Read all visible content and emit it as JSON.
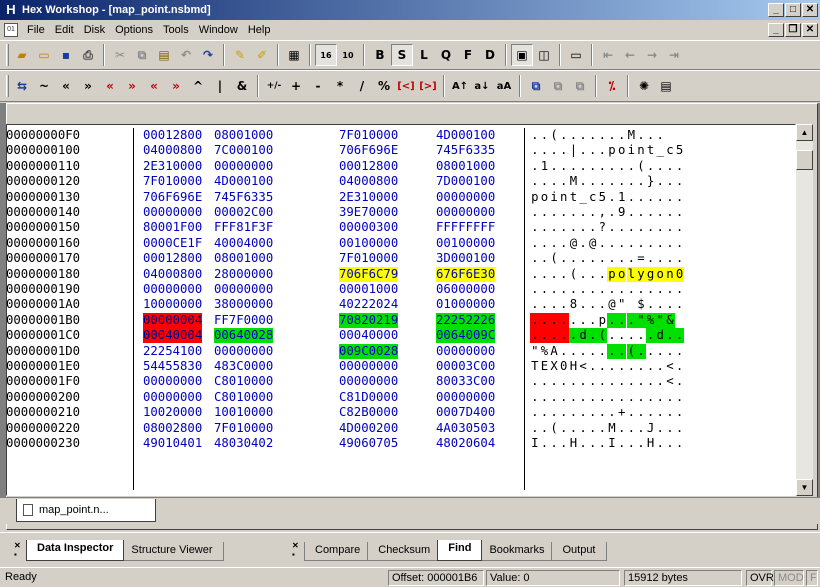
{
  "window": {
    "app_icon": "H",
    "title": "Hex Workshop - [map_point.nsbmd]"
  },
  "menu": [
    "File",
    "Edit",
    "Disk",
    "Options",
    "Tools",
    "Window",
    "Help"
  ],
  "toolbar1": {
    "edit_letters": [
      "B",
      "S",
      "L",
      "Q",
      "F",
      "D"
    ]
  },
  "toolbar2": {
    "ops": [
      "⇆",
      "~",
      "«",
      "»",
      "«",
      "»",
      "«",
      "»",
      "^",
      "|",
      "&",
      "+/-",
      "+",
      "-",
      "*",
      "/",
      "%",
      "[<]",
      "[>]",
      "A↑",
      "a↓",
      "aA"
    ]
  },
  "hex": {
    "rows": [
      {
        "addr": "00000000F0",
        "cols": [
          "00012800",
          "08001000",
          "7F010000",
          "4D000100"
        ],
        "ascii": "..(.......M..."
      },
      {
        "addr": "0000000100",
        "cols": [
          "04000800",
          "7C000100",
          "706F696E",
          "745F6335"
        ],
        "ascii": "....|...point_c5"
      },
      {
        "addr": "0000000110",
        "cols": [
          "2E310000",
          "00000000",
          "00012800",
          "08001000"
        ],
        "ascii": ".1.........(...."
      },
      {
        "addr": "0000000120",
        "cols": [
          "7F010000",
          "4D000100",
          "04000800",
          "7D000100"
        ],
        "ascii": "....M.......}..."
      },
      {
        "addr": "0000000130",
        "cols": [
          "706F696E",
          "745F6335",
          "2E310000",
          "00000000"
        ],
        "ascii": "point_c5.1......"
      },
      {
        "addr": "0000000140",
        "cols": [
          "00000000",
          "00002C00",
          "39E70000",
          "00000000"
        ],
        "ascii": ".......,.9......"
      },
      {
        "addr": "0000000150",
        "cols": [
          "80001F00",
          "FFF81F3F",
          "00000300",
          "FFFFFFFF"
        ],
        "ascii": ".......?........"
      },
      {
        "addr": "0000000160",
        "cols": [
          "0000CE1F",
          "40004000",
          "00100000",
          "00100000"
        ],
        "ascii": "....@.@........."
      },
      {
        "addr": "0000000170",
        "cols": [
          "00012800",
          "08001000",
          "7F010000",
          "3D000100"
        ],
        "ascii": "..(........=...."
      },
      {
        "addr": "0000000180",
        "cols": [
          "04000800",
          "28000000",
          "706F6C79",
          "676F6E30"
        ],
        "ascii": "....(...polygon0"
      },
      {
        "addr": "0000000190",
        "cols": [
          "00000000",
          "00000000",
          "00001000",
          "06000000"
        ],
        "ascii": "................"
      },
      {
        "addr": "00000001A0",
        "cols": [
          "10000000",
          "38000000",
          "40222024",
          "01000000"
        ],
        "ascii": "....8...@\" $...."
      },
      {
        "addr": "00000001B0",
        "cols": [
          "00000004",
          "FF7F0000",
          "70820219",
          "22252226"
        ],
        "ascii": ".......p...\"%\"&"
      },
      {
        "addr": "00000001C0",
        "cols": [
          "00040004",
          "00640028",
          "00040000",
          "0064009C"
        ],
        "ascii": ".....d.(.....d.."
      },
      {
        "addr": "00000001D0",
        "cols": [
          "22254100",
          "00000000",
          "009C0028",
          "00000000"
        ],
        "ascii": "\"%A.......(....."
      },
      {
        "addr": "00000001E0",
        "cols": [
          "54455830",
          "483C0000",
          "00000000",
          "00003C00"
        ],
        "ascii": "TEX0H<........<."
      },
      {
        "addr": "00000001F0",
        "cols": [
          "00000000",
          "C8010000",
          "00000000",
          "80033C00"
        ],
        "ascii": "..............<."
      },
      {
        "addr": "0000000200",
        "cols": [
          "00000000",
          "C8010000",
          "C81D0000",
          "00000000"
        ],
        "ascii": "................"
      },
      {
        "addr": "0000000210",
        "cols": [
          "10020000",
          "10010000",
          "C82B0000",
          "0007D400"
        ],
        "ascii": ".........+......"
      },
      {
        "addr": "0000000220",
        "cols": [
          "08002800",
          "7F010000",
          "4D000200",
          "4A030503"
        ],
        "ascii": "..(.....M...J..."
      },
      {
        "addr": "0000000230",
        "cols": [
          "49010401",
          "48030402",
          "49060705",
          "48020604"
        ],
        "ascii": "I...H...I...H..."
      }
    ],
    "highlight_colors": {
      "yellow": "#ffff00",
      "red": "#ff0000",
      "green": "#00e000"
    }
  },
  "doc_tab": "map_point.n...",
  "panels": {
    "left_tabs": [
      "Data Inspector",
      "Structure Viewer"
    ],
    "right_tabs": [
      "Compare",
      "Checksum",
      "Find",
      "Bookmarks",
      "Output"
    ]
  },
  "status": {
    "ready": "Ready",
    "offset": "Offset: 000001B6",
    "value": "Value: 0",
    "size": "15912 bytes",
    "ovr": "OVR",
    "mod": "MOD",
    "f": "F"
  }
}
